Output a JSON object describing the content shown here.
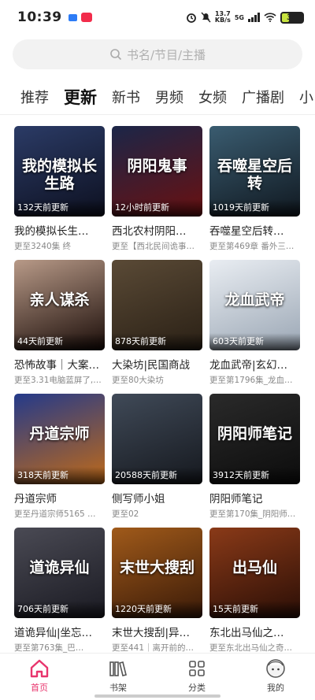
{
  "status": {
    "time": "10:39",
    "speed_top": "13.7",
    "speed_unit": "KB/s",
    "net": "5G",
    "battery": "34"
  },
  "search": {
    "placeholder": "书名/节目/主播"
  },
  "tabs": [
    "推荐",
    "更新",
    "新书",
    "男频",
    "女频",
    "广播剧",
    "小"
  ],
  "active_tab": "更新",
  "books": [
    {
      "cover_text": "我的模拟长生路",
      "ago": "132天前更新",
      "title": "我的模拟长生…",
      "sub": "更至3240集 终",
      "colors": [
        "#2b3b66",
        "#0d1020"
      ]
    },
    {
      "cover_text": "阴阳鬼事",
      "ago": "12小时前更新",
      "title": "西北农村阴阳…",
      "sub": "更至【西北民间诡事…",
      "colors": [
        "#1b2648",
        "#6a1010"
      ]
    },
    {
      "cover_text": "吞噬星空后转",
      "ago": "1019天前更新",
      "title": "吞噬星空后转…",
      "sub": "更至第469章 番外三…",
      "colors": [
        "#3a5c70",
        "#101820"
      ]
    },
    {
      "cover_text": "亲人谋杀",
      "ago": "44天前更新",
      "title": "恐怖故事｜大案…",
      "sub": "更至3.31电脑蓝屏了,…",
      "colors": [
        "#b89a88",
        "#1a0c08"
      ]
    },
    {
      "cover_text": "",
      "ago": "878天前更新",
      "title": "大染坊|民国商战",
      "sub": "更至80大染坊",
      "colors": [
        "#5a4a36",
        "#2a2015"
      ]
    },
    {
      "cover_text": "龙血武帝",
      "ago": "603天前更新",
      "title": "龙血武帝|玄幻…",
      "sub": "更至第1796集_龙血…",
      "colors": [
        "#e9edf2",
        "#9aa6b4"
      ]
    },
    {
      "cover_text": "丹道宗师",
      "ago": "318天前更新",
      "title": "丹道宗师",
      "sub": "更至丹道宗师5165 …",
      "colors": [
        "#243a8a",
        "#c06a18"
      ]
    },
    {
      "cover_text": "",
      "ago": "20588天前更新",
      "title": "侧写师小姐",
      "sub": "更至02",
      "colors": [
        "#404a58",
        "#15181e"
      ]
    },
    {
      "cover_text": "阴阳师笔记",
      "ago": "3912天前更新",
      "title": "阴阳师笔记",
      "sub": "更至第170集_阴阳师…",
      "colors": [
        "#2a2a2a",
        "#0c0c0c"
      ]
    },
    {
      "cover_text": "道诡异仙",
      "ago": "706天前更新",
      "title": "道诡异仙|坐忘…",
      "sub": "更至第763集_巴…",
      "colors": [
        "#4a4a54",
        "#1a1a22"
      ]
    },
    {
      "cover_text": "末世大搜刮",
      "ago": "1220天前更新",
      "title": "末世大搜刮|异…",
      "sub": "更至441｜离开前的…",
      "colors": [
        "#a05a1a",
        "#3a1a08"
      ]
    },
    {
      "cover_text": "出马仙",
      "ago": "15天前更新",
      "title": "东北出马仙之…",
      "sub": "更至东北出马仙之奇…",
      "colors": [
        "#8a3a18",
        "#2a0e06"
      ]
    }
  ],
  "nav": [
    {
      "label": "首页",
      "icon": "home-icon",
      "active": true
    },
    {
      "label": "书架",
      "icon": "bookshelf-icon",
      "active": false
    },
    {
      "label": "分类",
      "icon": "category-grid-icon",
      "active": false
    },
    {
      "label": "我的",
      "icon": "profile-avatar-icon",
      "active": false
    }
  ],
  "accent_color": "#e8356d"
}
